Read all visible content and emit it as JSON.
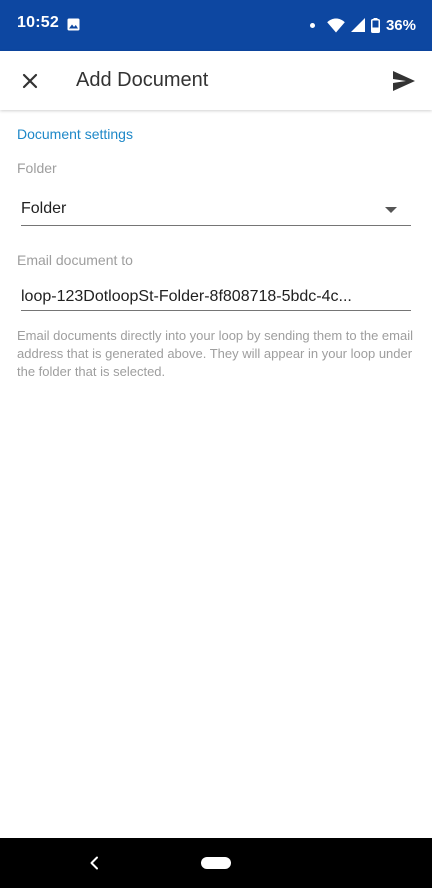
{
  "status_bar": {
    "time": "10:52",
    "battery": "36%",
    "icons": [
      "photo-icon",
      "notification-dot-icon",
      "wifi-icon",
      "cell-signal-icon",
      "battery-icon"
    ],
    "background": "#0d47a1"
  },
  "app_bar": {
    "title": "Add Document",
    "close_icon": "close-icon",
    "send_icon": "send-icon"
  },
  "form": {
    "section_title": "Document settings",
    "folder_label": "Folder",
    "folder_value": "Folder",
    "email_label": "Email document to",
    "email_value": "loop-123DotloopSt-Folder-8f808718-5bdc-4c...",
    "help_text": "Email documents directly into your loop by sending them to the email address that is generated above. They will appear in your loop under the folder that is selected.",
    "accent_color": "#1e88c8"
  },
  "nav_bar": {
    "back_icon": "back-chevron-icon",
    "home_icon": "home-pill-icon"
  }
}
